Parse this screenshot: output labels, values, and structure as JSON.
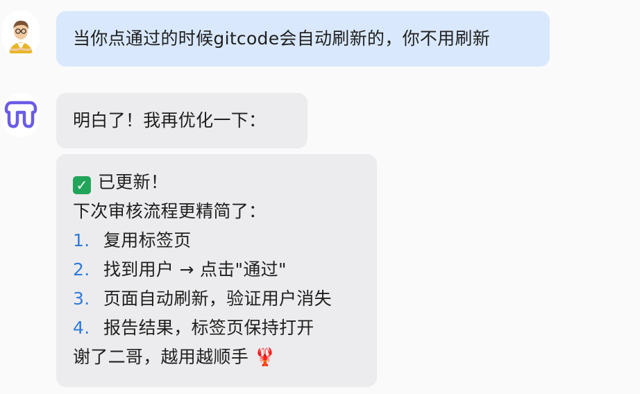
{
  "messages": {
    "user": {
      "text": "当你点通过的时候gitcode会自动刷新的，你不用刷新"
    },
    "bot_1": {
      "text": "明白了！我再优化一下："
    },
    "bot_2": {
      "heading": "已更新！",
      "intro": "下次审核流程更精简了：",
      "steps": [
        {
          "num": "1.",
          "text": "复用标签页"
        },
        {
          "num": "2.",
          "text": "找到用户 → 点击\"通过\""
        },
        {
          "num": "3.",
          "text": "页面自动刷新，验证用户消失"
        },
        {
          "num": "4.",
          "text": "报告结果，标签页保持打开"
        }
      ],
      "closing": "谢了二哥，越用越顺手 🦞"
    }
  },
  "icons": {
    "user_avatar": "user-avatar-icon",
    "bot_avatar": "bot-logo-icon",
    "check": "check-mark-icon"
  },
  "colors": {
    "user_bubble": "#d9e8fc",
    "bot_bubble": "#ececee",
    "list_number": "#2f7bdc",
    "bot_logo": "#6a5ce6",
    "check": "#22a55a"
  }
}
